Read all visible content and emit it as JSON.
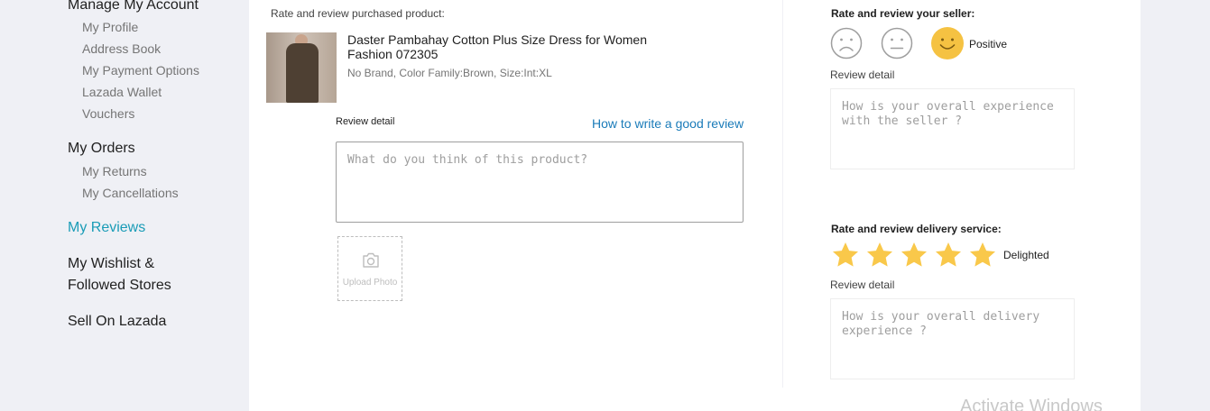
{
  "sidebar": {
    "manage_account": "Manage My Account",
    "account_items": [
      "My Profile",
      "Address Book",
      "My Payment Options",
      "Lazada Wallet",
      "Vouchers"
    ],
    "my_orders": "My Orders",
    "order_items": [
      "My Returns",
      "My Cancellations"
    ],
    "my_reviews": "My Reviews",
    "wishlist_line1": "My Wishlist &",
    "wishlist_line2": "Followed Stores",
    "sell": "Sell On Lazada",
    "active_color": "#1a9cb7"
  },
  "product_review": {
    "heading": "Rate and review purchased product:",
    "product_name": "Daster Pambahay Cotton Plus Size Dress for Women Fashion 072305",
    "product_sku": "No Brand, Color Family:Brown, Size:Int:XL",
    "review_detail_label": "Review detail",
    "how_to_link": "How to write a good review",
    "placeholder": "What do you think of this product?",
    "upload_label": "Upload Photo",
    "icons": {
      "upload": "camera-icon"
    }
  },
  "seller_review": {
    "heading": "Rate and review your seller:",
    "faces": [
      "negative-face-icon",
      "neutral-face-icon",
      "positive-face-icon"
    ],
    "selected_label": "Positive",
    "review_detail_label": "Review detail",
    "placeholder": "How is your overall experience with the seller ?",
    "selected_color": "#f5c242"
  },
  "delivery_review": {
    "heading": "Rate and review delivery service:",
    "rating": 5,
    "max_rating": 5,
    "rating_label": "Delighted",
    "review_detail_label": "Review detail",
    "placeholder": "How is your overall delivery experience ?",
    "star_color": "#f9c84a"
  },
  "watermark": "Activate Windows"
}
